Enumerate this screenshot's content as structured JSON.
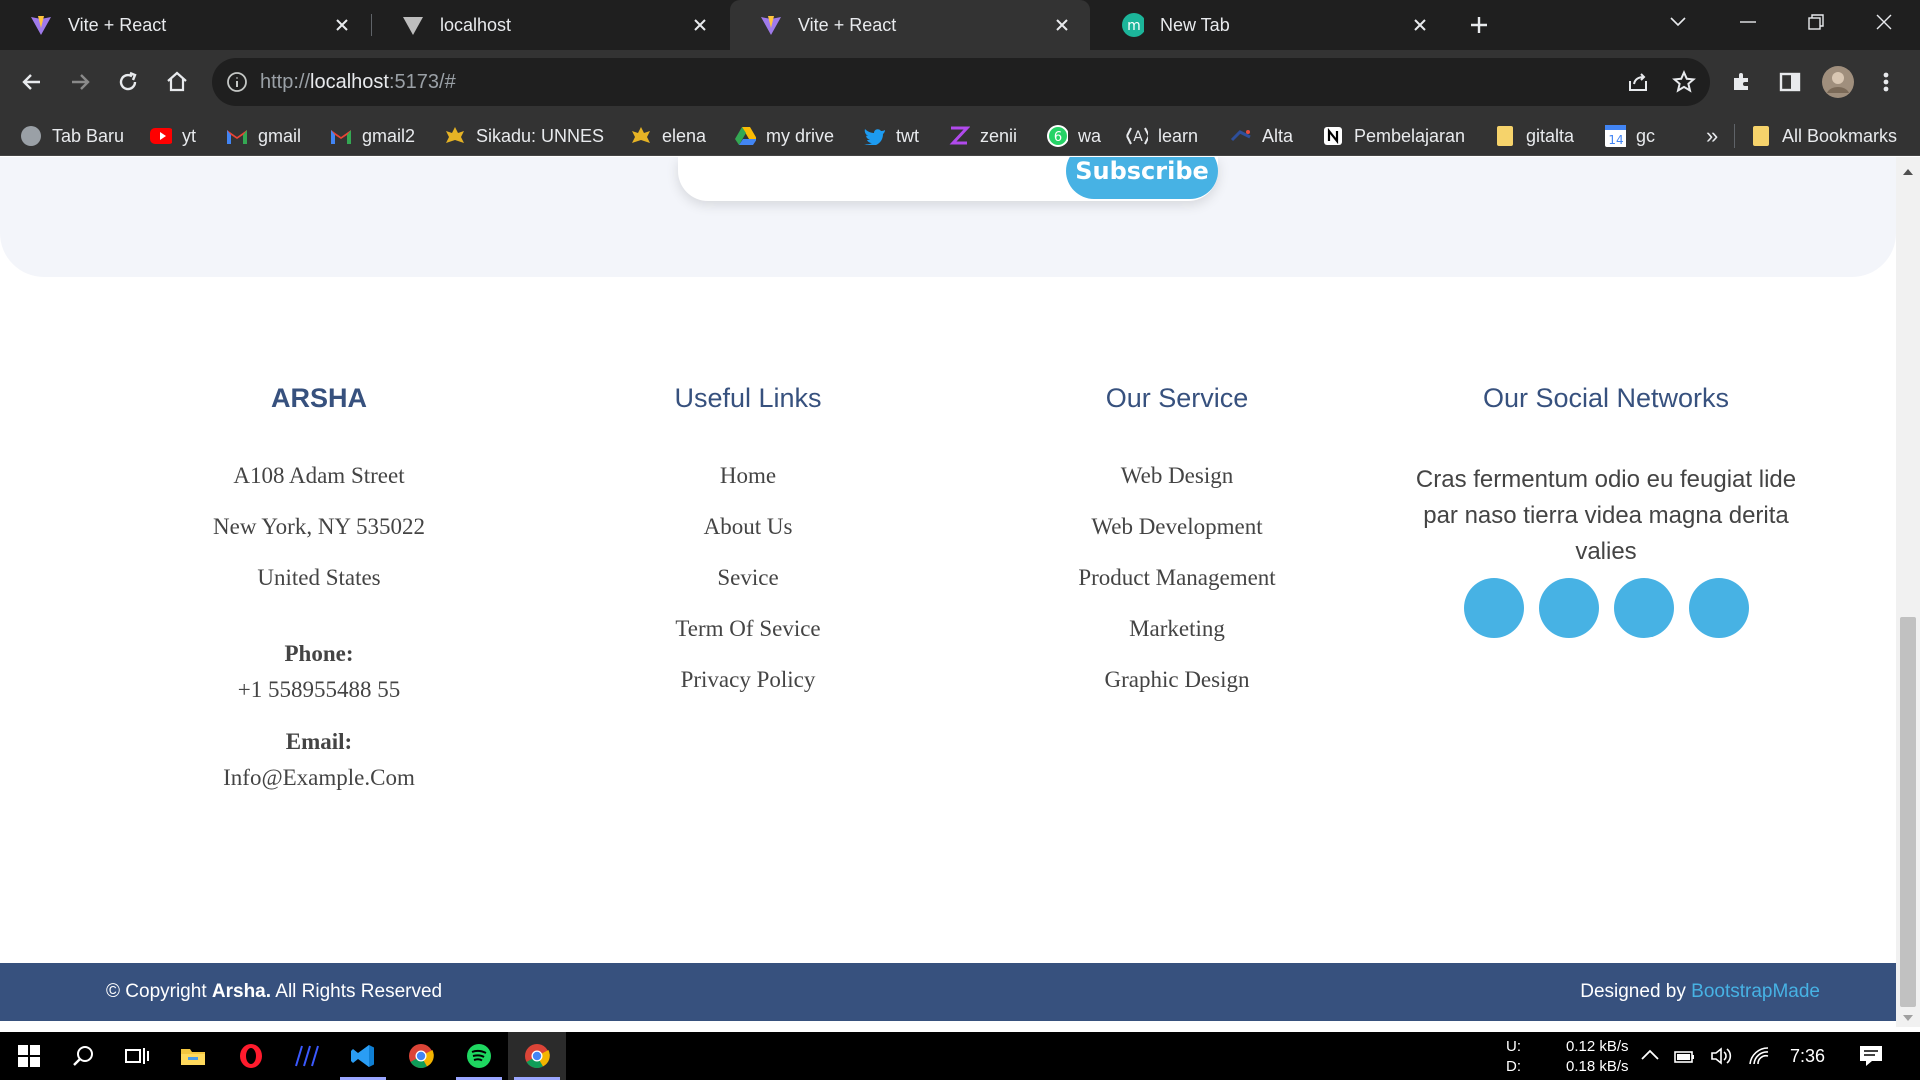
{
  "browser": {
    "tabs": [
      {
        "title": "Vite + React",
        "icon": "vite-icon"
      },
      {
        "title": "localhost",
        "icon": "vite-gray-icon"
      },
      {
        "title": "Vite + React",
        "icon": "vite-icon",
        "active": true
      },
      {
        "title": "New Tab",
        "icon": "m-icon"
      }
    ],
    "url_scheme": "http://",
    "url_host": "localhost",
    "url_rest": ":5173/#",
    "bookmarks": [
      {
        "label": "Tab Baru"
      },
      {
        "label": "yt"
      },
      {
        "label": "gmail"
      },
      {
        "label": "gmail2"
      },
      {
        "label": "Sikadu: UNNES"
      },
      {
        "label": "elena"
      },
      {
        "label": "my drive"
      },
      {
        "label": "twt"
      },
      {
        "label": "zenii"
      },
      {
        "label": "wa"
      },
      {
        "label": "learn"
      },
      {
        "label": "Alta"
      },
      {
        "label": "Pembelajaran"
      },
      {
        "label": "gitalta"
      },
      {
        "label": "gc"
      }
    ],
    "bookmarks_more": "»",
    "all_bookmarks": "All Bookmarks"
  },
  "page": {
    "subscribe_label": "Subscribe",
    "footer": {
      "brand": {
        "title": "ARSHA",
        "address": [
          "A108 Adam Street",
          "New York, NY 535022",
          "United States"
        ],
        "phone_label": "Phone:",
        "phone": "+1 558955488 55",
        "email_label": "Email:",
        "email": "Info@Example.Com"
      },
      "useful_links": {
        "title": "Useful Links",
        "items": [
          "Home",
          "About Us",
          "Sevice",
          "Term Of Sevice",
          "Privacy Policy"
        ]
      },
      "services": {
        "title": "Our Service",
        "items": [
          "Web Design",
          "Web Development",
          "Product Management",
          "Marketing",
          "Graphic Design"
        ]
      },
      "social": {
        "title": "Our Social Networks",
        "text": "Cras fermentum odio eu feugiat lide par naso tierra videa magna derita valies"
      }
    },
    "copyright_prefix": "© Copyright",
    "copyright_brand": "Arsha.",
    "copyright_suffix": "All Rights Reserved",
    "designed_by": "Designed by",
    "designer": "BootstrapMade"
  },
  "taskbar": {
    "net_up_label": "U:",
    "net_down_label": "D:",
    "net_up": "0.12 kB/s",
    "net_down": "0.18 kB/s",
    "clock": "7:36"
  },
  "colors": {
    "accent": "#47b2e4",
    "navy": "#37517e"
  }
}
